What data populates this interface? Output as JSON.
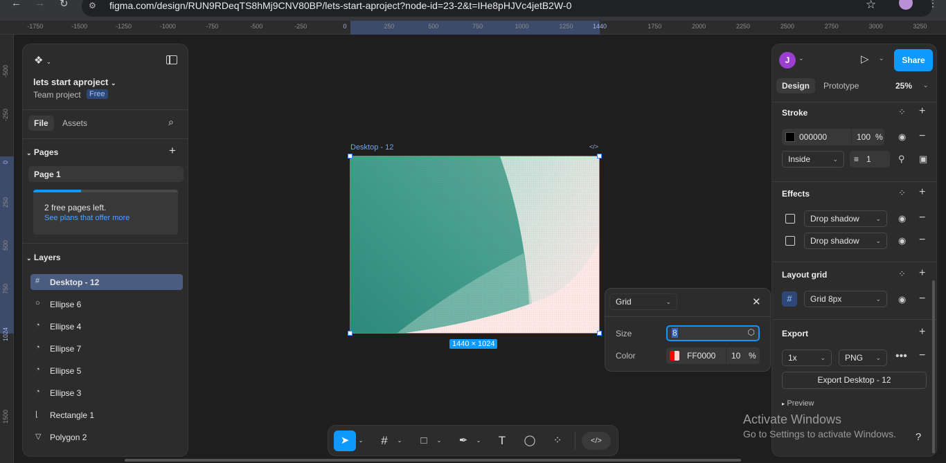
{
  "browser": {
    "url": "figma.com/design/RUN9RDeqTS8hMj9CNV80BP/lets-start-aproject?node-id=23-2&t=IHe8pHJVc4jetB2W-0",
    "back_icon": "arrow-left-icon",
    "forward_icon": "arrow-right-icon",
    "reload_icon": "reload-icon"
  },
  "rulers": {
    "horizontal": [
      "-1750",
      "-1500",
      "-1250",
      "-1000",
      "-750",
      "-500",
      "-250",
      "0",
      "250",
      "500",
      "750",
      "1000",
      "1250",
      "1440",
      "1750",
      "2000",
      "2250",
      "2500",
      "2750",
      "3000",
      "3250"
    ],
    "vertical": [
      "-500",
      "-250",
      "0",
      "250",
      "500",
      "750",
      "1024",
      "1500"
    ]
  },
  "left_panel": {
    "project_name": "lets start aproject",
    "team": "Team project",
    "plan_badge": "Free",
    "tabs": [
      "File",
      "Assets"
    ],
    "pages_title": "Pages",
    "page_item": "Page 1",
    "promo_text": "2 free pages left.",
    "promo_link": "See plans that offer more",
    "promo_progress": 0.33,
    "layers_title": "Layers",
    "layers": [
      {
        "name": "Desktop - 12",
        "icon": "#"
      },
      {
        "name": "Ellipse 6",
        "icon": "○"
      },
      {
        "name": "Ellipse 4",
        "icon": "◔"
      },
      {
        "name": "Ellipse 7",
        "icon": "◔"
      },
      {
        "name": "Ellipse 5",
        "icon": "◔"
      },
      {
        "name": "Ellipse 3",
        "icon": "◔"
      },
      {
        "name": "Rectangle 1",
        "icon": "⌊"
      },
      {
        "name": "Polygon 2",
        "icon": "▽"
      }
    ]
  },
  "canvas": {
    "frame_label": "Desktop - 12",
    "frame_size": "1440 × 1024",
    "code_icon": "</>"
  },
  "popover": {
    "type": "Grid",
    "size_label": "Size",
    "size_value": "8",
    "color_label": "Color",
    "color_hex": "FF0000",
    "color_opacity": "10",
    "percent": "%",
    "swatch": "#ff0000"
  },
  "right_panel": {
    "avatar_initial": "J",
    "avatar_color": "#9b3fd1",
    "share_label": "Share",
    "tabs": [
      "Design",
      "Prototype"
    ],
    "zoom": "25%",
    "stroke": {
      "title": "Stroke",
      "hex": "000000",
      "opacity": "100",
      "percent": "%",
      "position": "Inside",
      "weight": "1"
    },
    "effects": {
      "title": "Effects",
      "items": [
        "Drop shadow",
        "Drop shadow"
      ]
    },
    "layout_grid": {
      "title": "Layout grid",
      "item": "Grid 8px"
    },
    "export": {
      "title": "Export",
      "scale": "1x",
      "format": "PNG",
      "button": "Export Desktop - 12",
      "preview": "Preview"
    }
  },
  "watermark": {
    "title": "Activate Windows",
    "subtitle": "Go to Settings to activate Windows."
  },
  "help": "?",
  "colors": {
    "accent": "#0d99ff",
    "selection": "#2f8df5",
    "frame_teal": "#2e8b7e",
    "frame_pink": "#fbeaea"
  }
}
